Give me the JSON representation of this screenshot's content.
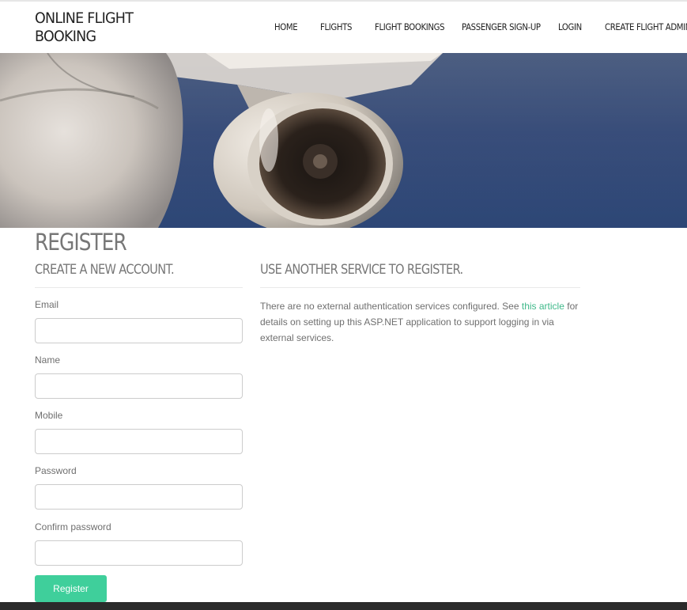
{
  "header": {
    "brand_line1": "ONLINE FLIGHT",
    "brand_line2": "BOOKING",
    "nav": {
      "home": "HOME",
      "flights": "FLIGHTS",
      "flight_bookings": "FLIGHT BOOKINGS",
      "passenger_signup": "PASSENGER SIGN-UP",
      "login": "LOGIN",
      "create_flight_admin": "CREATE FLIGHT ADMIN"
    }
  },
  "hero": {
    "image": "airplane-engine-photo"
  },
  "main": {
    "title": "REGISTER",
    "left_heading": "CREATE A NEW ACCOUNT.",
    "right_heading": "USE ANOTHER SERVICE TO REGISTER.",
    "form": {
      "email_label": "Email",
      "email_value": "",
      "name_label": "Name",
      "name_value": "",
      "mobile_label": "Mobile",
      "mobile_value": "",
      "password_label": "Password",
      "password_value": "",
      "confirm_label": "Confirm password",
      "confirm_value": "",
      "submit_label": "Register"
    },
    "external": {
      "text_before": "There are no external authentication services configured. See ",
      "link_text": "this article",
      "text_after": " for details on setting up this ASP.NET application to support logging in via external services."
    }
  },
  "colors": {
    "accent": "#3fcf9b",
    "link": "#3fb98a",
    "footer": "#2b2b2b"
  }
}
